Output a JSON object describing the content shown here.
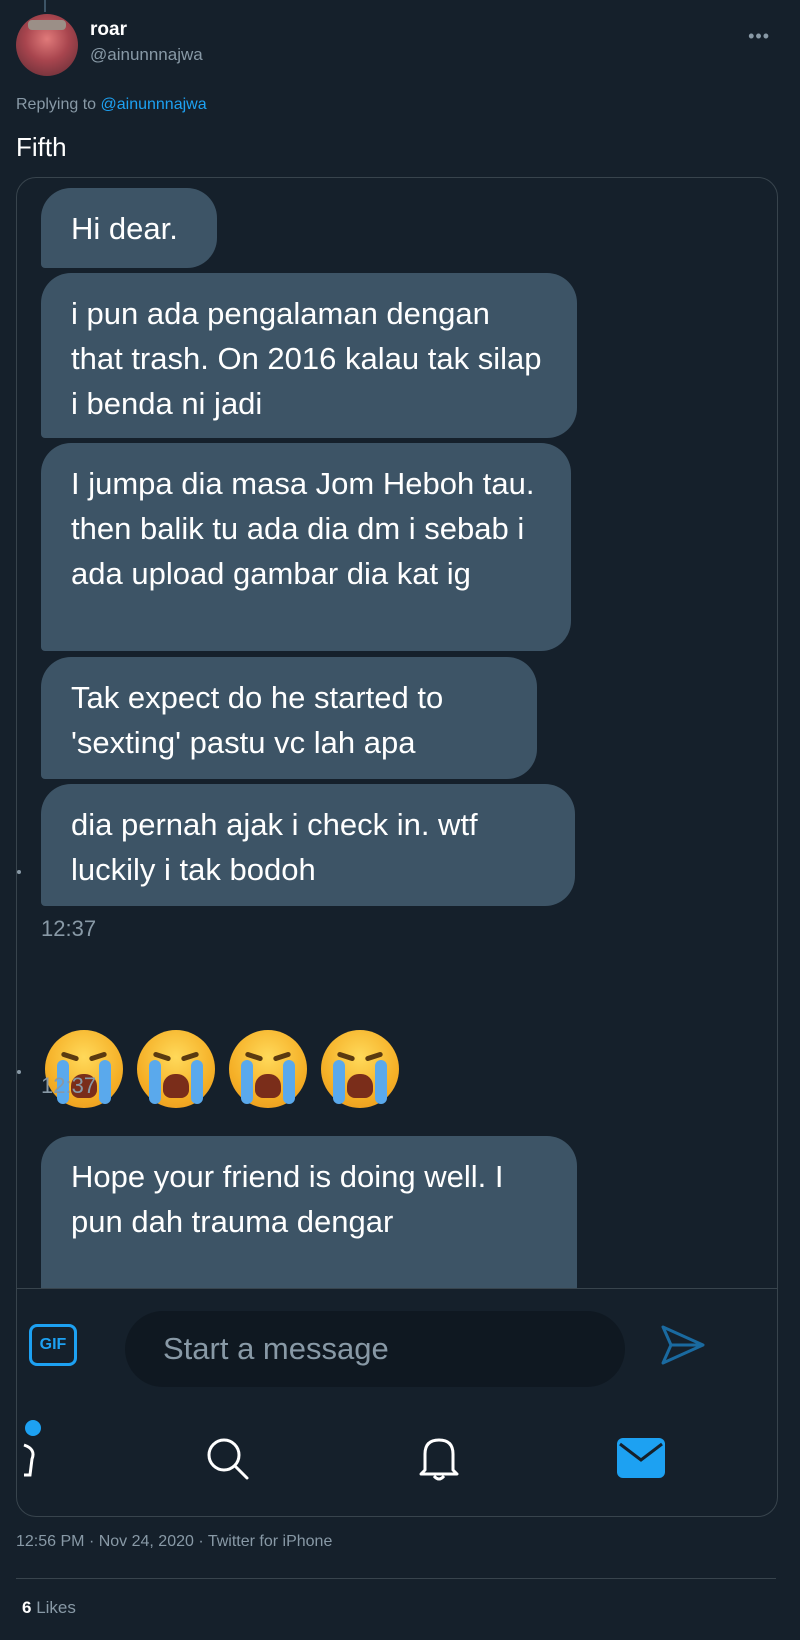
{
  "author": {
    "display_name": "roar",
    "handle": "@ainunnnajwa"
  },
  "reply": {
    "prefix": "Replying to",
    "to": "@ainunnnajwa"
  },
  "tweet_text": "Fifth",
  "dm": {
    "messages": [
      "Hi dear.",
      "i pun ada pengalaman dengan that trash. On 2016 kalau tak silap i benda ni jadi",
      "I jumpa dia masa Jom Heboh tau. then balik tu ada dia dm i sebab i ada upload gambar dia kat ig",
      "Tak expect do he started to 'sexting' pastu vc lah apa",
      "dia pernah ajak i check in. wtf luckily i tak bodoh"
    ],
    "time_1": "12:37",
    "emoji_message": "😭😭😭😭",
    "time_2": "12:37",
    "partial_message": "Hope your friend is doing well. I pun dah trauma dengar",
    "gif_label": "GIF",
    "input_placeholder": "Start a message"
  },
  "nav": {
    "icons": [
      "person-icon",
      "search-icon",
      "bell-icon",
      "mail-icon"
    ],
    "active": "mail-icon"
  },
  "meta": {
    "time": "12:56 PM",
    "date": "Nov 24, 2020",
    "client": "Twitter for iPhone"
  },
  "likes": {
    "count": "6",
    "label": "Likes"
  },
  "colors": {
    "background": "#15202b",
    "bubble": "#3d5466",
    "accent": "#1da1f2",
    "muted": "#8899a6"
  }
}
